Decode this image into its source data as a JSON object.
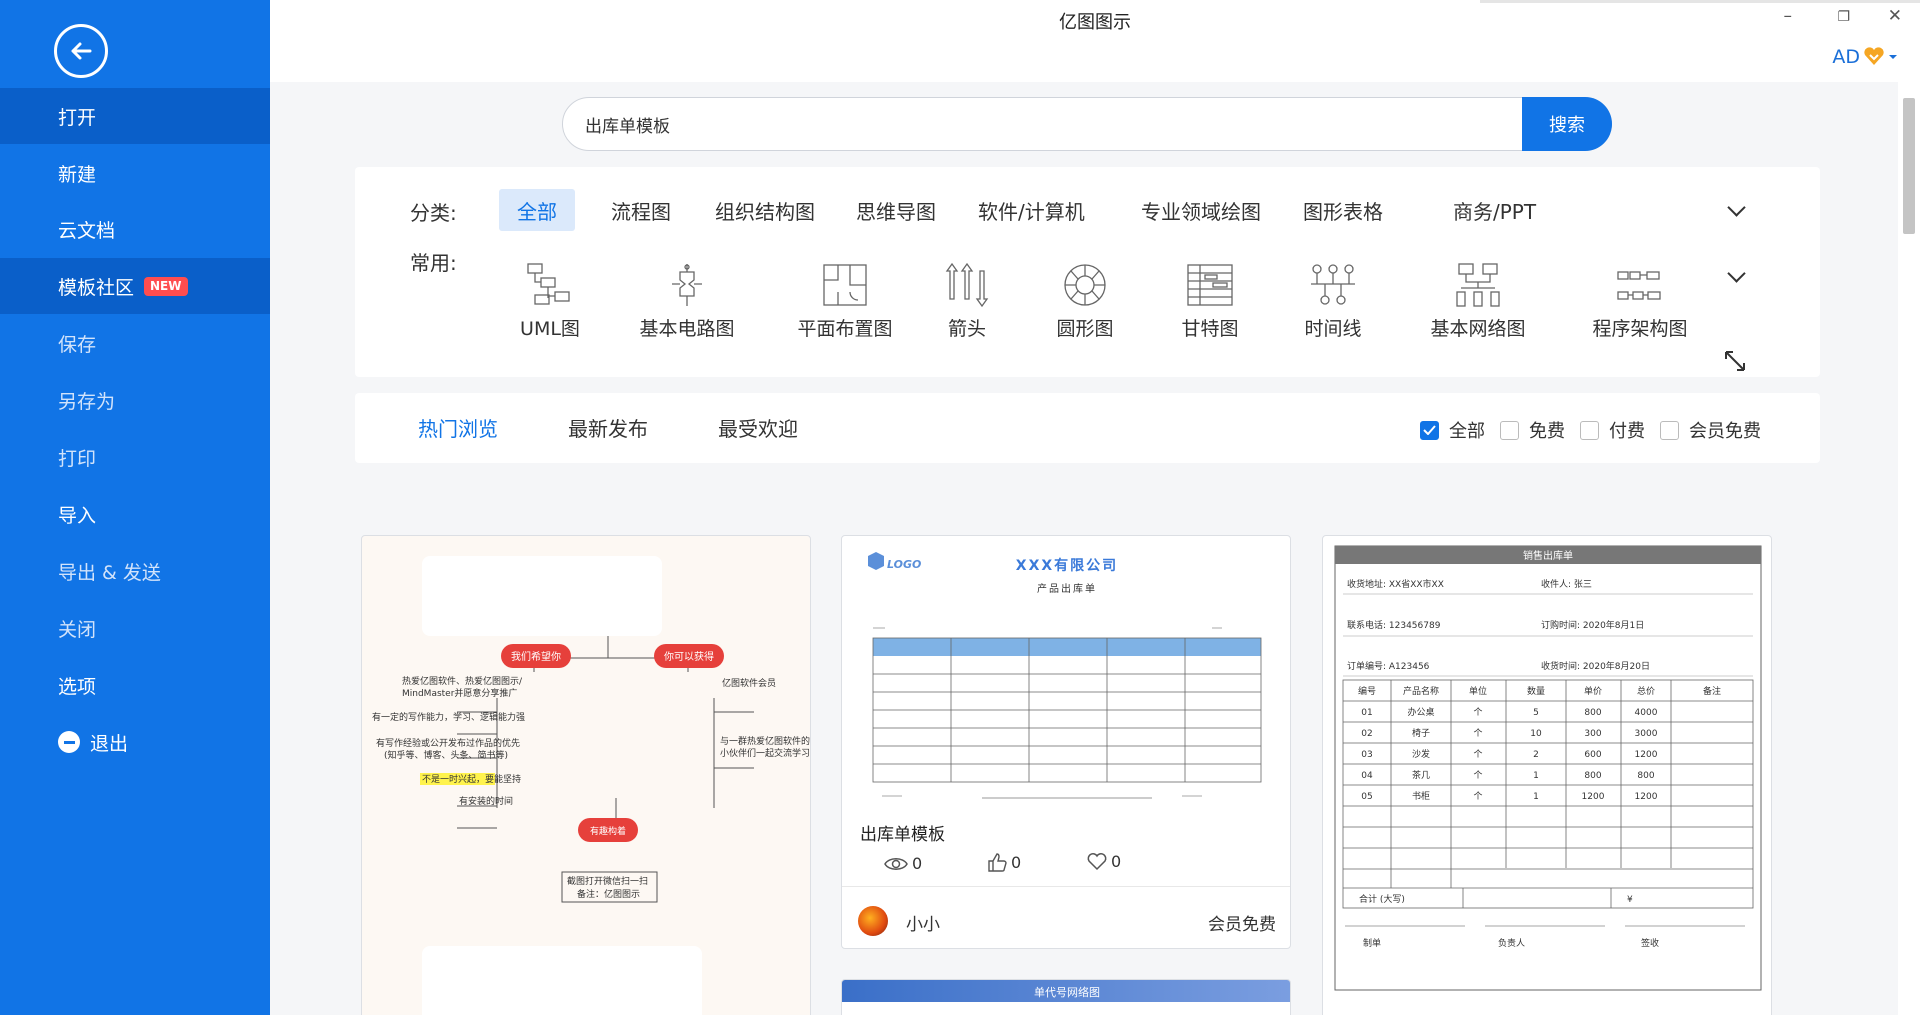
{
  "window": {
    "title": "亿图图示",
    "minimize": "–",
    "restore": "❐",
    "close": "✕",
    "user": "AD"
  },
  "sidebar": {
    "items": [
      {
        "label": "打开"
      },
      {
        "label": "新建"
      },
      {
        "label": "云文档"
      },
      {
        "label": "模板社区",
        "badge": "NEW"
      },
      {
        "label": "保存"
      },
      {
        "label": "另存为"
      },
      {
        "label": "打印"
      },
      {
        "label": "导入"
      },
      {
        "label": "导出 & 发送"
      },
      {
        "label": "关闭"
      },
      {
        "label": "选项"
      },
      {
        "label": "退出"
      }
    ]
  },
  "search": {
    "value": "出库单模板",
    "button": "搜索"
  },
  "categories": {
    "label": "分类:",
    "items": [
      "全部",
      "流程图",
      "组织结构图",
      "思维导图",
      "软件/计算机",
      "专业领域绘图",
      "图形表格",
      "商务/PPT"
    ]
  },
  "common": {
    "label": "常用:",
    "items": [
      "UML图",
      "基本电路图",
      "平面布置图",
      "箭头",
      "圆形图",
      "甘特图",
      "时间线",
      "基本网络图",
      "程序架构图"
    ]
  },
  "sort_tabs": [
    "热门浏览",
    "最新发布",
    "最受欢迎"
  ],
  "price_filters": [
    {
      "label": "全部",
      "checked": true
    },
    {
      "label": "免费",
      "checked": false
    },
    {
      "label": "付费",
      "checked": false
    },
    {
      "label": "会员免费",
      "checked": false
    }
  ],
  "cards": {
    "mindmap": {
      "topic_left": "我们希望你",
      "topic_right": "你可以获得",
      "topic_bottom": "有趣构着",
      "lines_left": [
        "热爱亿图软件、热爱亿图图示/",
        "MindMaster并愿意分享推广",
        "有一定的写作能力，学习、逻辑能力强",
        "有写作经验或公开发布过作品的优先",
        "(知乎等、博客、头条、简书等)",
        "不是一时兴起，要能坚持",
        "有安装的时间"
      ],
      "lines_right": [
        "亿图软件会员",
        "与一群热爱亿图软件的",
        "小伙伴们一起交流学习"
      ],
      "lines_bottom": [
        "截图打开微信扫一扫",
        "备注：亿图图示"
      ]
    },
    "outbound": {
      "logo": "LOGO",
      "company": "XXX有限公司",
      "subtitle": "产品出库单",
      "title": "出库单模板",
      "views": "0",
      "likes": "0",
      "favorites": "0",
      "author": "小小",
      "price": "会员免费"
    },
    "sales": {
      "header": "销售出库单",
      "receive_addr": "收货地址: XX省XX市XX",
      "receiver": "收件人: 张三",
      "phone": "联系电话: 123456789",
      "order_time": "订购时间: 2020年8月1日",
      "order_no": "订单编号: A123456",
      "receive_time": "收货时间: 2020年8月20日",
      "columns": [
        "编号",
        "产品名称",
        "单位",
        "数量",
        "单价",
        "总价",
        "备注"
      ],
      "rows": [
        [
          "01",
          "办公桌",
          "个",
          "5",
          "800",
          "4000",
          ""
        ],
        [
          "02",
          "椅子",
          "个",
          "10",
          "300",
          "3000",
          ""
        ],
        [
          "03",
          "沙发",
          "个",
          "2",
          "600",
          "1200",
          ""
        ],
        [
          "04",
          "茶几",
          "个",
          "1",
          "800",
          "800",
          ""
        ],
        [
          "05",
          "书柜",
          "个",
          "1",
          "1200",
          "1200",
          ""
        ]
      ],
      "total_label": "合计 (大写)",
      "currency": "¥",
      "sign1": "制单",
      "sign2": "负责人",
      "sign3": "签收"
    },
    "partial": {
      "header": "单代号网络图"
    }
  },
  "colors": {
    "primary": "#1174e6",
    "sidebar_active": "#0a5fc9",
    "badge": "#ff4d4f"
  }
}
